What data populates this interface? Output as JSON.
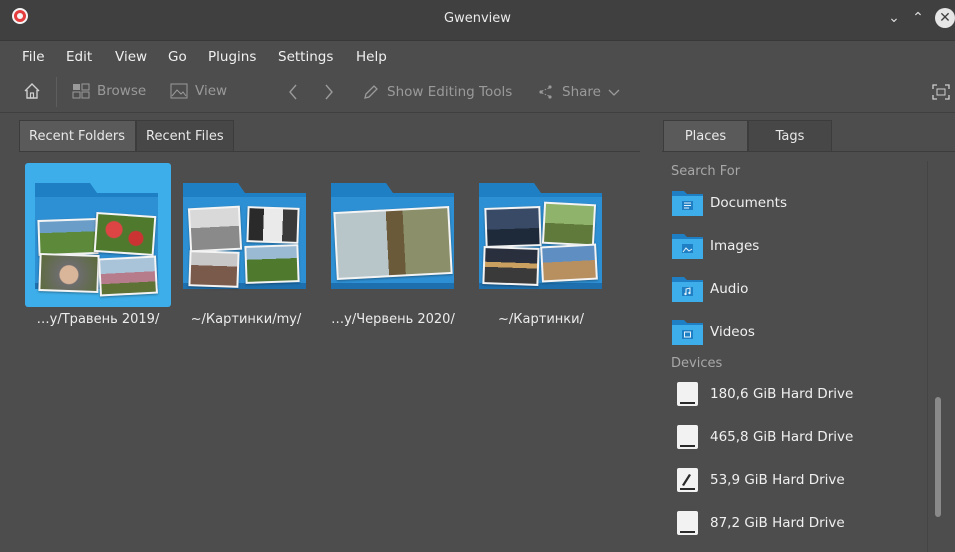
{
  "window": {
    "title": "Gwenview"
  },
  "titlebar": {
    "minimize_glyph": "⌄",
    "maximize_glyph": "⌃",
    "close_glyph": "✕"
  },
  "menu": [
    "File",
    "Edit",
    "View",
    "Go",
    "Plugins",
    "Settings",
    "Help"
  ],
  "toolbar": {
    "browse_label": "Browse",
    "view_label": "View",
    "editing_label": "Show Editing Tools",
    "share_label": "Share"
  },
  "left_tabs": [
    "Recent Folders",
    "Recent Files"
  ],
  "folders": [
    {
      "label": "…y/Травень 2019/",
      "selected": true
    },
    {
      "label": "~/Картинки/my/",
      "selected": false
    },
    {
      "label": "…y/Червень 2020/",
      "selected": false
    },
    {
      "label": "~/Картинки/",
      "selected": false
    }
  ],
  "right_tabs": [
    "Places",
    "Tags"
  ],
  "search_for": {
    "heading": "Search For",
    "items": [
      "Documents",
      "Images",
      "Audio",
      "Videos"
    ]
  },
  "devices": {
    "heading": "Devices",
    "items": [
      "180,6 GiB Hard Drive",
      "465,8 GiB Hard Drive",
      "53,9 GiB Hard Drive",
      "87,2 GiB Hard Drive"
    ]
  },
  "colors": {
    "accent": "#3daee9",
    "background": "#4d4d4d",
    "folder_blue": "#2e90d4"
  },
  "icons": [
    "home-icon",
    "browse-icon",
    "view-icon",
    "back-icon",
    "forward-icon",
    "pen-icon",
    "share-icon",
    "fullscreen-icon"
  ]
}
